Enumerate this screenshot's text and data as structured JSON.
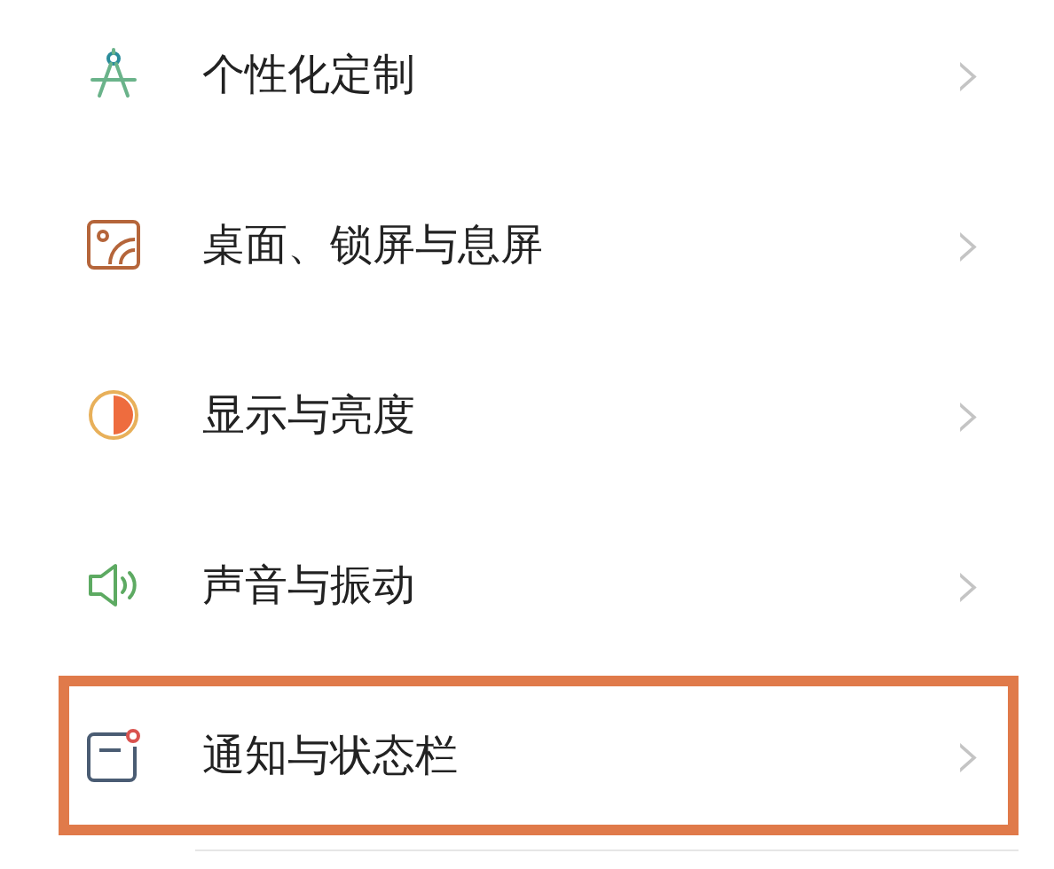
{
  "settings_items": [
    {
      "kind": "customize",
      "label": "个性化定制",
      "chevron": "›",
      "highlighted": false
    },
    {
      "kind": "wallpaper",
      "label": "桌面、锁屏与息屏",
      "chevron": "›",
      "highlighted": false
    },
    {
      "kind": "display",
      "label": "显示与亮度",
      "chevron": "›",
      "highlighted": false
    },
    {
      "kind": "sound",
      "label": "声音与振动",
      "chevron": "›",
      "highlighted": false
    },
    {
      "kind": "notification",
      "label": "通知与状态栏",
      "chevron": "›",
      "highlighted": true
    }
  ]
}
